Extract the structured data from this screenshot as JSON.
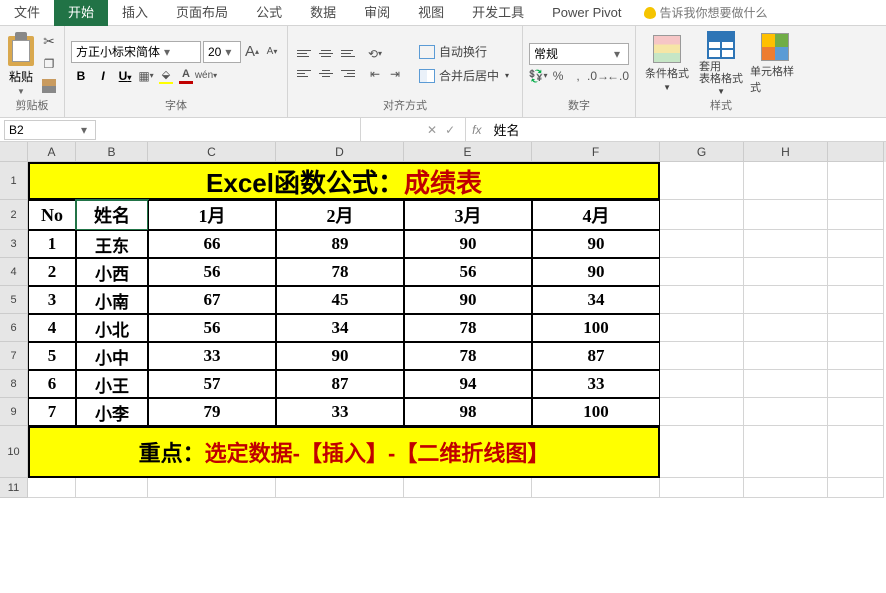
{
  "tabs": {
    "file": "文件",
    "home": "开始",
    "insert": "插入",
    "layout": "页面布局",
    "formulas": "公式",
    "data": "数据",
    "review": "审阅",
    "view": "视图",
    "dev": "开发工具",
    "pivot": "Power Pivot",
    "tellme": "告诉我你想要做什么"
  },
  "ribbon": {
    "clipboard": {
      "label": "剪贴板",
      "paste": "粘贴"
    },
    "font": {
      "label": "字体",
      "name": "方正小标宋简体",
      "size": "20"
    },
    "alignment": {
      "label": "对齐方式",
      "wrap": "自动换行",
      "merge": "合并后居中"
    },
    "number": {
      "label": "数字",
      "format": "常规"
    },
    "styles": {
      "label": "样式",
      "cf": "条件格式",
      "table": "套用\n表格格式",
      "cell": "单元格样式"
    }
  },
  "fx": {
    "cell_ref": "B2",
    "formula": "姓名"
  },
  "cols": [
    "A",
    "B",
    "C",
    "D",
    "E",
    "F",
    "G",
    "H"
  ],
  "title": {
    "part1": "Excel函数公式：",
    "part2": "成绩表"
  },
  "headers": {
    "no": "No",
    "name": "姓名",
    "m1": "1月",
    "m2": "2月",
    "m3": "3月",
    "m4": "4月"
  },
  "rows": [
    {
      "no": "1",
      "name": "王东",
      "m1": "66",
      "m2": "89",
      "m3": "90",
      "m4": "90"
    },
    {
      "no": "2",
      "name": "小西",
      "m1": "56",
      "m2": "78",
      "m3": "56",
      "m4": "90"
    },
    {
      "no": "3",
      "name": "小南",
      "m1": "67",
      "m2": "45",
      "m3": "90",
      "m4": "34"
    },
    {
      "no": "4",
      "name": "小北",
      "m1": "56",
      "m2": "34",
      "m3": "78",
      "m4": "100"
    },
    {
      "no": "5",
      "name": "小中",
      "m1": "33",
      "m2": "90",
      "m3": "78",
      "m4": "87"
    },
    {
      "no": "6",
      "name": "小王",
      "m1": "57",
      "m2": "87",
      "m3": "94",
      "m4": "33"
    },
    {
      "no": "7",
      "name": "小李",
      "m1": "79",
      "m2": "33",
      "m3": "98",
      "m4": "100"
    }
  ],
  "note": {
    "part1": "重点：",
    "part2": "选定数据-【插入】-【二维折线图】"
  },
  "rowNums": [
    "1",
    "2",
    "3",
    "4",
    "5",
    "6",
    "7",
    "8",
    "9",
    "10",
    "11"
  ]
}
